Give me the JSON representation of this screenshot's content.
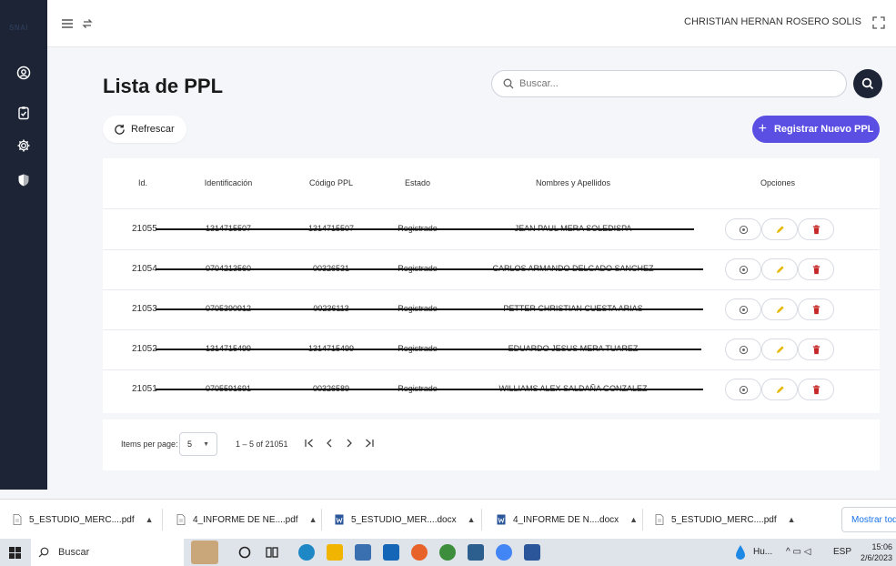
{
  "sidebar": {
    "logo": "SNAI",
    "items": [
      "user-circle-icon",
      "clipboard-icon",
      "gear-icon",
      "shield-icon"
    ]
  },
  "header": {
    "user_name": "CHRISTIAN HERNAN ROSERO SOLIS"
  },
  "main": {
    "title": "Lista de PPL",
    "search_placeholder": "Buscar...",
    "refresh_label": "Refrescar",
    "new_label": "Registrar Nuevo PPL"
  },
  "table": {
    "columns": [
      "Id.",
      "Identificación",
      "Código PPL",
      "Estado",
      "Nombres y Apellidos",
      "Opciones"
    ],
    "rows": [
      {
        "id": "21055",
        "identificacion": "1314715507",
        "codigo": "1314715507",
        "estado": "Registrado",
        "nombre": "JEAN PAUL MERA SOLEDISPA"
      },
      {
        "id": "21054",
        "identificacion": "0704213560",
        "codigo": "00326531",
        "estado": "Registrado",
        "nombre": "CARLOS ARMANDO DELGADO SANCHEZ"
      },
      {
        "id": "21053",
        "identificacion": "0705390912",
        "codigo": "00236113",
        "estado": "Registrado",
        "nombre": "PETTER CHRISTIAN CUESTA ARIAS"
      },
      {
        "id": "21052",
        "identificacion": "1314715499",
        "codigo": "1314715499",
        "estado": "Registrado",
        "nombre": "EDUARDO JESUS MERA TUAREZ"
      },
      {
        "id": "21051",
        "identificacion": "0705591691",
        "codigo": "00326589",
        "estado": "Registrado",
        "nombre": "WILLIAMS ALEX SALDAÑA GONZALEZ"
      }
    ]
  },
  "pager": {
    "items_label": "Items per page:",
    "page_size": "5",
    "range": "1 – 5 of 21051"
  },
  "downloads": {
    "items": [
      {
        "name": "5_ESTUDIO_MERC....pdf",
        "type": "pdf"
      },
      {
        "name": "4_INFORME DE NE....pdf",
        "type": "pdf"
      },
      {
        "name": "5_ESTUDIO_MER....docx",
        "type": "docx"
      },
      {
        "name": "4_INFORME DE N....docx",
        "type": "docx"
      },
      {
        "name": "5_ESTUDIO_MERC....pdf",
        "type": "pdf"
      }
    ],
    "show_all": "Mostrar todo"
  },
  "taskbar": {
    "search_label": "Buscar",
    "weather": "Hu...",
    "lang": "ESP",
    "time": "15:06",
    "date": "2/6/2023"
  },
  "colors": {
    "sidebar": "#1c2435",
    "accent": "#5b4fe3",
    "delete": "#c62828",
    "edit": "#e6b800"
  }
}
